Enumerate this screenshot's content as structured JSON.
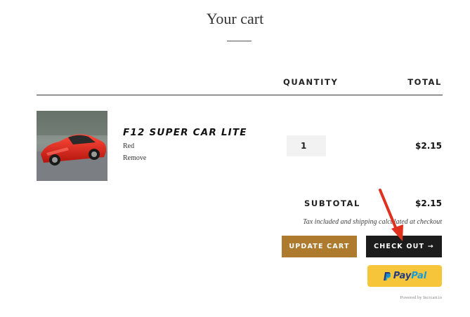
{
  "page": {
    "title": "Your cart"
  },
  "table": {
    "headers": {
      "quantity": "QUANTITY",
      "total": "TOTAL"
    }
  },
  "item": {
    "name": "F12 SUPER CAR LITE",
    "variant": "Red",
    "remove_label": "Remove",
    "quantity": "1",
    "line_total": "$2.15"
  },
  "summary": {
    "subtotal_label": "SUBTOTAL",
    "subtotal_value": "$2.15",
    "tax_note": "Tax included and shipping calculated at checkout"
  },
  "buttons": {
    "update_cart": "UPDATE CART",
    "checkout": "CHECK OUT →",
    "paypal_pay": "Pay",
    "paypal_pal": "Pal"
  },
  "footer": {
    "powered_by": "Powered by Incrcart.io"
  },
  "colors": {
    "update_button": "#ad7a2e",
    "checkout_button": "#1c1c1c",
    "paypal_button": "#f7c53a",
    "annotation_arrow": "#e0301e"
  },
  "icons": {
    "annotation": "red-arrow-icon",
    "product": "red-sports-car-image",
    "paypal": "paypal-logo-icon"
  }
}
